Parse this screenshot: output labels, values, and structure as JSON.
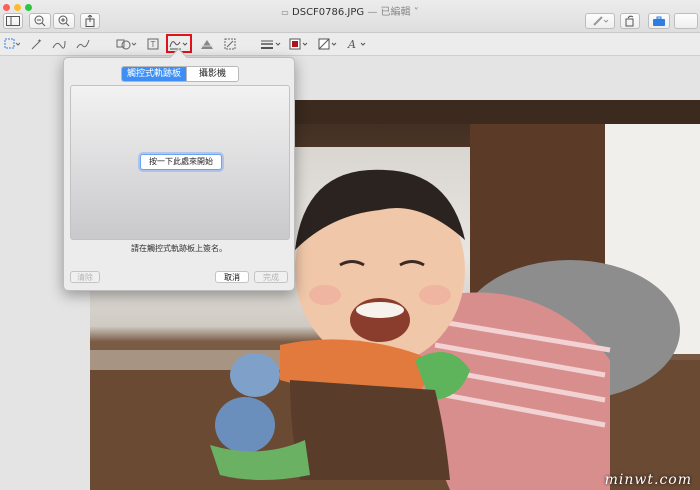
{
  "window": {
    "title": "DSCF0786.JPG",
    "title_sep": "—",
    "title_status": "已編輯",
    "title_chevron": "˅"
  },
  "toolbar": {
    "top_icons": [
      "sidebar-icon",
      "zoom-out-icon",
      "zoom-in-icon",
      "share-icon",
      "markup-pen-icon",
      "rotate-icon",
      "toolbox-icon"
    ],
    "markup_icons": [
      "selection-icon",
      "instant-alpha-icon",
      "sketch-icon",
      "draw-icon",
      "shapes-icon",
      "text-icon",
      "sign-icon",
      "adjust-color-icon",
      "adjust-size-icon",
      "shape-style-icon",
      "border-color-icon",
      "fill-color-icon",
      "text-style-icon"
    ],
    "highlighted": "sign-icon",
    "highlight_color": "#e0121a"
  },
  "sheet": {
    "tabs": [
      {
        "label": "觸控式軌跡板",
        "selected": true
      },
      {
        "label": "攝影機",
        "selected": false
      }
    ],
    "start_button": "按一下此處來開始",
    "hint": "請在觸控式軌跡板上簽名。",
    "clear_button": "清除",
    "cancel_button": "取消",
    "done_button": "完成",
    "accent": "#3d8ff6"
  },
  "watermark": "minwt.com"
}
